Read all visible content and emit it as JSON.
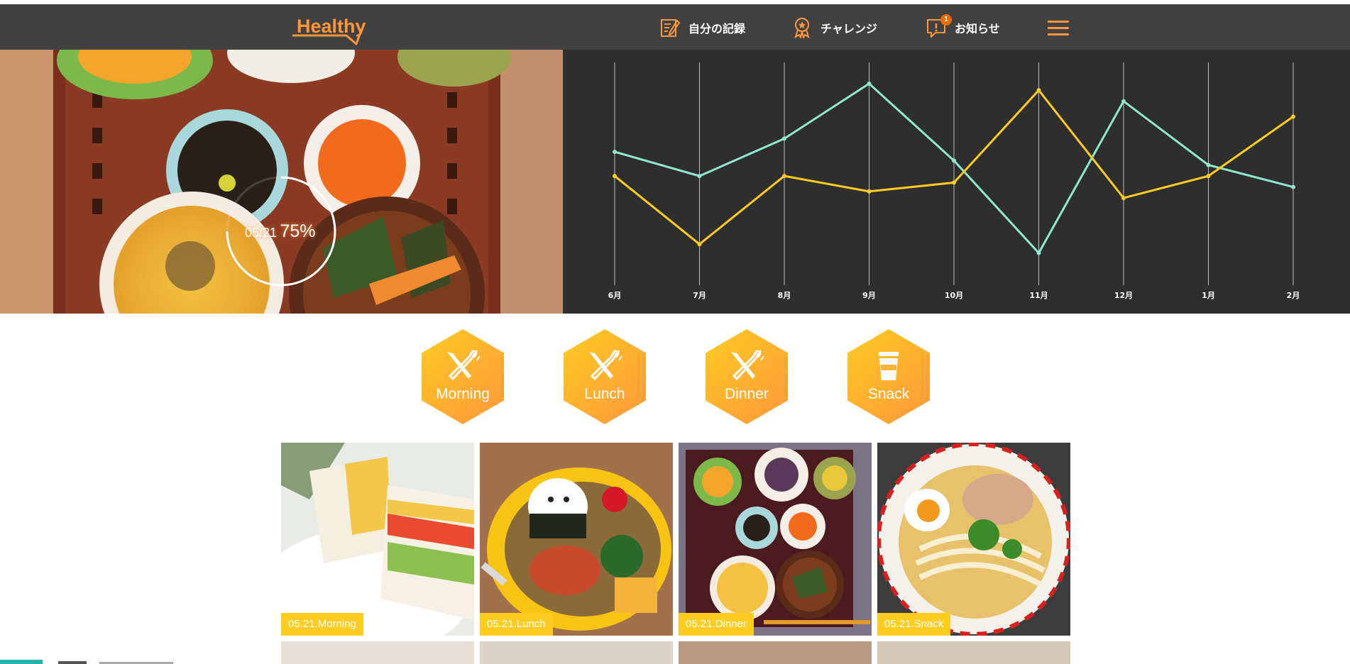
{
  "header": {
    "logo_text": "Healthy",
    "nav": {
      "records": "自分の記録",
      "challenge": "チャレンジ",
      "news": "お知らせ",
      "news_badge": "1"
    }
  },
  "hero": {
    "date": "05/21",
    "percent": "75%",
    "progress": 0.75
  },
  "chart_data": {
    "type": "line",
    "categories": [
      "6月",
      "7月",
      "8月",
      "9月",
      "10月",
      "11月",
      "12月",
      "1月",
      "2月"
    ],
    "series": [
      {
        "values": [
          60,
          49,
          66,
          91,
          56,
          14,
          83,
          54,
          44
        ],
        "color": "#8fe9d0"
      },
      {
        "values": [
          49,
          18,
          49,
          42,
          46,
          88,
          39,
          49,
          76
        ],
        "color": "#ffcc21"
      }
    ],
    "ylim": [
      0,
      100
    ],
    "grid": "vertical"
  },
  "meals": [
    {
      "label": "Morning",
      "icon": "knife-fork-icon"
    },
    {
      "label": "Lunch",
      "icon": "knife-fork-icon"
    },
    {
      "label": "Dinner",
      "icon": "knife-fork-icon"
    },
    {
      "label": "Snack",
      "icon": "cup-icon"
    }
  ],
  "tiles": [
    {
      "caption": "05.21.Morning"
    },
    {
      "caption": "05.21.Lunch"
    },
    {
      "caption": "05.21.Dinner"
    },
    {
      "caption": "05.21.Snack"
    }
  ],
  "colors": {
    "accent": "#ff963c",
    "primary": "#ffcc21",
    "dark": "#414141",
    "line_teal": "#8fe9d0"
  }
}
